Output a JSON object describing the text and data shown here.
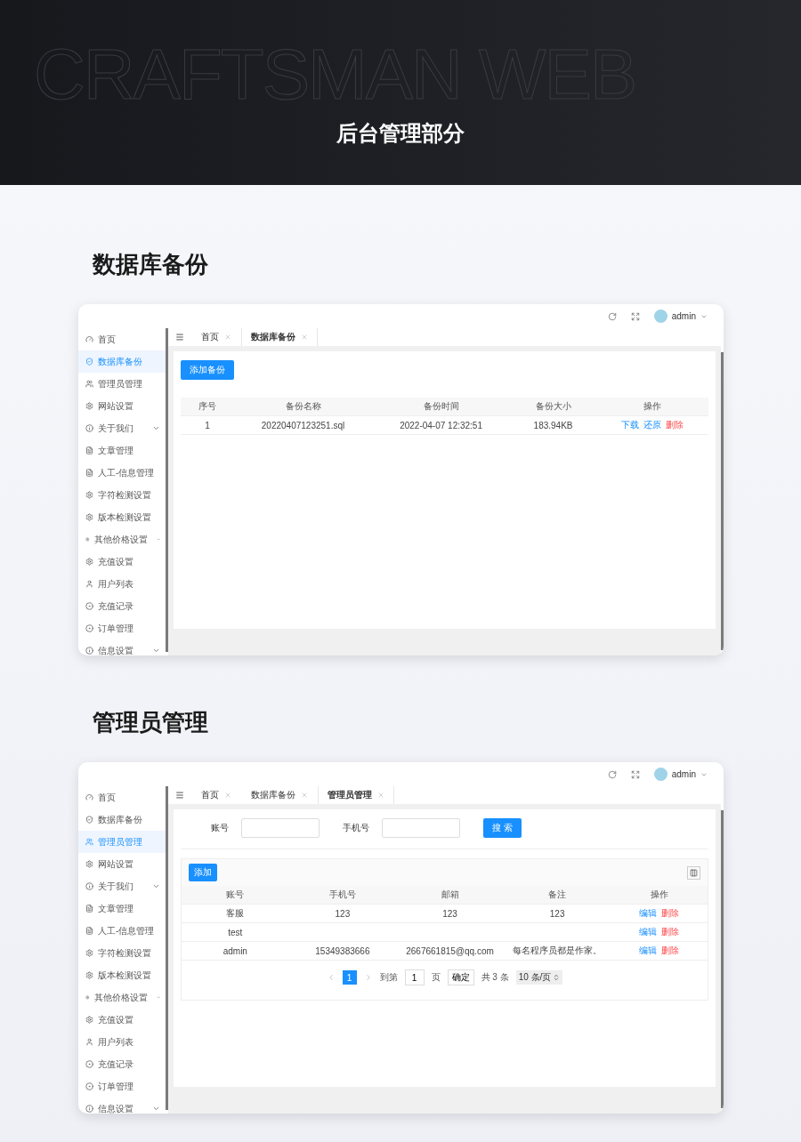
{
  "banner": {
    "background_text": "CRAFTSMAN WEB",
    "title": "后台管理部分"
  },
  "sections": [
    {
      "heading": "数据库备份",
      "screen": {
        "user": "admin",
        "sidebar": [
          {
            "label": "首页",
            "expandable": false,
            "selected": false
          },
          {
            "label": "数据库备份",
            "expandable": false,
            "selected": true
          },
          {
            "label": "管理员管理",
            "expandable": false,
            "selected": false
          },
          {
            "label": "网站设置",
            "expandable": false,
            "selected": false
          },
          {
            "label": "关于我们",
            "expandable": true,
            "selected": false
          },
          {
            "label": "文章管理",
            "expandable": false,
            "selected": false
          },
          {
            "label": "人工-信息管理",
            "expandable": false,
            "selected": false
          },
          {
            "label": "字符检测设置",
            "expandable": false,
            "selected": false
          },
          {
            "label": "版本检测设置",
            "expandable": false,
            "selected": false
          },
          {
            "label": "其他价格设置",
            "expandable": true,
            "selected": false
          },
          {
            "label": "充值设置",
            "expandable": false,
            "selected": false
          },
          {
            "label": "用户列表",
            "expandable": false,
            "selected": false
          },
          {
            "label": "充值记录",
            "expandable": false,
            "selected": false
          },
          {
            "label": "订单管理",
            "expandable": false,
            "selected": false
          },
          {
            "label": "信息设置",
            "expandable": true,
            "selected": false
          }
        ],
        "tabs": [
          {
            "label": "首页",
            "selected": false
          },
          {
            "label": "数据库备份",
            "selected": true
          }
        ],
        "content": {
          "kind": "backup",
          "add_button": "添加备份",
          "columns": [
            "序号",
            "备份名称",
            "备份时间",
            "备份大小",
            "操作"
          ],
          "rows": [
            {
              "cells": [
                "1",
                "20220407123251.sql",
                "2022-04-07 12:32:51",
                "183.94KB"
              ],
              "actions": [
                {
                  "label": "下载",
                  "kind": "link"
                },
                {
                  "label": "还原",
                  "kind": "link"
                },
                {
                  "label": "删除",
                  "kind": "danger"
                }
              ]
            }
          ]
        }
      }
    },
    {
      "heading": "管理员管理",
      "screen": {
        "user": "admin",
        "sidebar": [
          {
            "label": "首页",
            "expandable": false,
            "selected": false
          },
          {
            "label": "数据库备份",
            "expandable": false,
            "selected": false
          },
          {
            "label": "管理员管理",
            "expandable": false,
            "selected": true
          },
          {
            "label": "网站设置",
            "expandable": false,
            "selected": false
          },
          {
            "label": "关于我们",
            "expandable": true,
            "selected": false
          },
          {
            "label": "文章管理",
            "expandable": false,
            "selected": false
          },
          {
            "label": "人工-信息管理",
            "expandable": false,
            "selected": false
          },
          {
            "label": "字符检测设置",
            "expandable": false,
            "selected": false
          },
          {
            "label": "版本检测设置",
            "expandable": false,
            "selected": false
          },
          {
            "label": "其他价格设置",
            "expandable": true,
            "selected": false
          },
          {
            "label": "充值设置",
            "expandable": false,
            "selected": false
          },
          {
            "label": "用户列表",
            "expandable": false,
            "selected": false
          },
          {
            "label": "充值记录",
            "expandable": false,
            "selected": false
          },
          {
            "label": "订单管理",
            "expandable": false,
            "selected": false
          },
          {
            "label": "信息设置",
            "expandable": true,
            "selected": false
          }
        ],
        "tabs": [
          {
            "label": "首页",
            "selected": false
          },
          {
            "label": "数据库备份",
            "selected": false
          },
          {
            "label": "管理员管理",
            "selected": true
          }
        ],
        "content": {
          "kind": "admins",
          "filters": [
            {
              "label": "账号"
            },
            {
              "label": "手机号"
            }
          ],
          "search_button": "搜 索",
          "add_button": "添加",
          "columns": [
            "账号",
            "手机号",
            "邮箱",
            "备注",
            "操作"
          ],
          "rows": [
            {
              "cells": {
                "account": "客服",
                "phone": "123",
                "email": "123",
                "note": "123"
              },
              "actions": [
                {
                  "label": "编辑",
                  "kind": "link"
                },
                {
                  "label": "删除",
                  "kind": "danger"
                }
              ]
            },
            {
              "cells": {
                "account": "test"
              },
              "actions": [
                {
                  "label": "编辑",
                  "kind": "link"
                },
                {
                  "label": "删除",
                  "kind": "danger"
                }
              ]
            },
            {
              "cells": {
                "account": "admin",
                "phone": "15349383666",
                "email": "2667661815@qq.com",
                "note": "每名程序员都是作家。"
              },
              "actions": [
                {
                  "label": "编辑",
                  "kind": "link"
                },
                {
                  "label": "删除",
                  "kind": "danger"
                }
              ]
            }
          ],
          "pagination": {
            "pages": [
              {
                "label": "1",
                "selected": true
              }
            ],
            "goto_label": "到第",
            "goto_value": "1",
            "page_unit": "页",
            "confirm": "确定",
            "total": "共 3 条",
            "page_size": "10 条/页"
          }
        }
      }
    }
  ]
}
